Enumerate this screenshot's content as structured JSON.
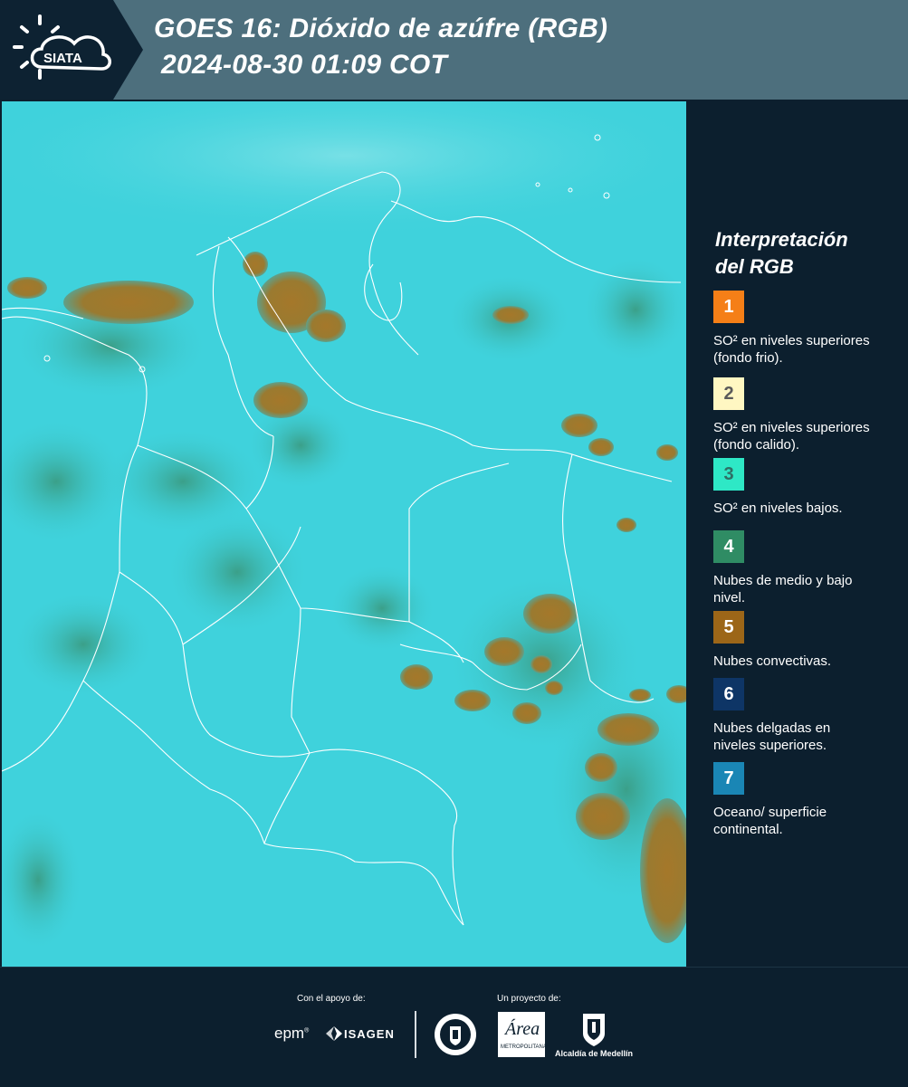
{
  "header": {
    "brand": "SIATA",
    "title_line1": "GOES 16: Dióxido de azúfre (RGB)",
    "title_line2": "2024-08-30 01:09 COT"
  },
  "legend": {
    "title_line1": "Interpretación",
    "title_line2": "del RGB",
    "items": [
      {
        "number": "1",
        "label": "SO² en niveles superiores (fondo frio).",
        "color": "#f57f17",
        "text_color": "#ffffff"
      },
      {
        "number": "2",
        "label": "SO² en niveles superiores (fondo calido).",
        "color": "#fff7c2",
        "text_color": "#5a5a5a"
      },
      {
        "number": "3",
        "label": "SO² en niveles bajos.",
        "color": "#2ee8c6",
        "text_color": "#2f6f65"
      },
      {
        "number": "4",
        "label": "Nubes de medio y bajo nivel.",
        "color": "#2f8c64",
        "text_color": "#ffffff"
      },
      {
        "number": "5",
        "label": "Nubes convectivas.",
        "color": "#9c6618",
        "text_color": "#ffffff"
      },
      {
        "number": "6",
        "label": "Nubes delgadas en niveles superiores.",
        "color": "#0e3566",
        "text_color": "#ffffff"
      },
      {
        "number": "7",
        "label": "Oceano/ superficie continental.",
        "color": "#1a86b5",
        "text_color": "#ffffff"
      }
    ]
  },
  "footer": {
    "support_label": "Con el apoyo de:",
    "project_label": "Un proyecto de:",
    "sponsor_epm": "epm",
    "sponsor_isagen": "ISAGEN",
    "sponsor_area": "Área",
    "sponsor_area_sub": "METROPOLITANA",
    "sponsor_alcaldia": "Alcaldía de Medellín"
  },
  "map_colors": {
    "background": "#3fd2dc",
    "convective": "#9c7a2c",
    "low_clouds": "#3aa88a",
    "borders": "#ffffff"
  }
}
